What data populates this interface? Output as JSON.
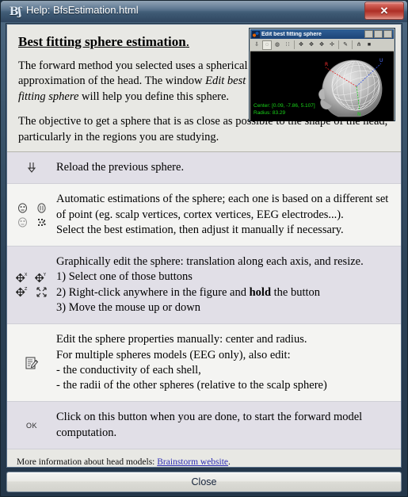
{
  "window": {
    "title": "Help: BfsEstimation.html",
    "app_icon": "brainstorm-logo-icon",
    "close_label": "✕"
  },
  "document": {
    "heading": "Best fitting sphere estimation",
    "heading_suffix": ".",
    "paragraphs": [
      {
        "id": "p1",
        "segments": [
          {
            "text": "The forward method you selected uses a spherical approximation of the head. The window ",
            "style": "normal"
          },
          {
            "text": "Edit best fitting sphere",
            "style": "italic"
          },
          {
            "text": " will help you define this sphere.",
            "style": "normal"
          }
        ]
      },
      {
        "id": "p2",
        "segments": [
          {
            "text": "The objective to get a sphere that is as close as possible to the shape of the head, particularly in the regions you are studying.",
            "style": "normal"
          }
        ]
      }
    ]
  },
  "figure": {
    "title": "Edit best fitting sphere",
    "app_icon": "matlab-icon",
    "window_buttons": [
      "minimize",
      "maximize",
      "close"
    ],
    "toolbar_icons": [
      "rotate-icon",
      "sphere-scalp-icon",
      "sphere-cortex-icon",
      "sphere-electrodes-icon",
      "move-x-icon",
      "move-y-icon",
      "move-z-icon",
      "resize-icon",
      "edit-properties-icon",
      "ok-icon",
      "more-icon"
    ],
    "overlay_center": "Center: [0.09, -7.86, 5.107]",
    "overlay_radius": "Radius: 83.29",
    "axis_labels": [
      "R",
      "U",
      "N"
    ],
    "colors": {
      "canvas": "#000000",
      "mesh": "#c6c6c6",
      "label_green": "#19d419",
      "label_red": "#e02020",
      "label_blue": "#3050e0"
    }
  },
  "rows": [
    {
      "id": "reload",
      "icons": [
        "down-arrow-icon"
      ],
      "icon_layout": "single",
      "lines": [
        {
          "segments": [
            {
              "text": "Reload the previous sphere.",
              "style": "normal"
            }
          ]
        }
      ]
    },
    {
      "id": "auto-estimations",
      "icons": [
        "sphere-scalp-icon",
        "sphere-head-icon",
        "sphere-cortex-icon",
        "sphere-electrodes-icon"
      ],
      "icon_layout": "grid",
      "lines": [
        {
          "segments": [
            {
              "text": "Automatic estimations of the sphere; each one is based on a different set",
              "style": "normal"
            }
          ]
        },
        {
          "segments": [
            {
              "text": "of point (eg. scalp vertices, cortex vertices, EEG electrodes...).",
              "style": "normal"
            }
          ]
        },
        {
          "segments": [
            {
              "text": "Select the best estimation, then adjust it manually if necessary.",
              "style": "normal"
            }
          ]
        }
      ]
    },
    {
      "id": "graphical-edit",
      "icons": [
        "move-x-icon",
        "move-y-icon",
        "move-z-icon",
        "resize-icon"
      ],
      "icon_layout": "grid",
      "lines": [
        {
          "segments": [
            {
              "text": "Graphically edit the sphere: translation along each axis, and resize.",
              "style": "normal"
            }
          ]
        },
        {
          "segments": [
            {
              "text": "1) Select one of those buttons",
              "style": "normal"
            }
          ]
        },
        {
          "segments": [
            {
              "text": "2) Right-click anywhere in the figure and ",
              "style": "normal"
            },
            {
              "text": "hold",
              "style": "bold"
            },
            {
              "text": " the button",
              "style": "normal"
            }
          ]
        },
        {
          "segments": [
            {
              "text": "3) Move the mouse up or down",
              "style": "normal"
            }
          ]
        }
      ]
    },
    {
      "id": "manual-edit",
      "icons": [
        "edit-document-icon"
      ],
      "icon_layout": "single",
      "lines": [
        {
          "segments": [
            {
              "text": "Edit the sphere properties manually: center and radius.",
              "style": "normal"
            }
          ]
        },
        {
          "segments": [
            {
              "text": "For multiple spheres models (EEG only), also edit:",
              "style": "normal"
            }
          ]
        },
        {
          "segments": [
            {
              "text": "- the conductivity of each shell,",
              "style": "normal"
            }
          ]
        },
        {
          "segments": [
            {
              "text": "- the radii of the other spheres (relative to the scalp sphere)",
              "style": "normal"
            }
          ]
        }
      ]
    },
    {
      "id": "ok-compute",
      "icons": [
        "ok-icon"
      ],
      "icon_layout": "single",
      "icon_text": "OK",
      "lines": [
        {
          "segments": [
            {
              "text": "Click on this button when you are done, to start the forward model",
              "style": "normal"
            }
          ]
        },
        {
          "segments": [
            {
              "text": "computation.",
              "style": "normal"
            }
          ]
        }
      ]
    }
  ],
  "footer": {
    "prefix": "More information about head models: ",
    "link_text": "Brainstorm website",
    "suffix": "."
  },
  "buttons": {
    "close": "Close"
  },
  "colors": {
    "frame": "#2f4660",
    "row_alt": "#e1dfe7",
    "row_plain": "#f4f4f2",
    "page_bg": "#e8e8e4",
    "link": "#2d2db4",
    "close_button_red": "#ad2f26"
  }
}
